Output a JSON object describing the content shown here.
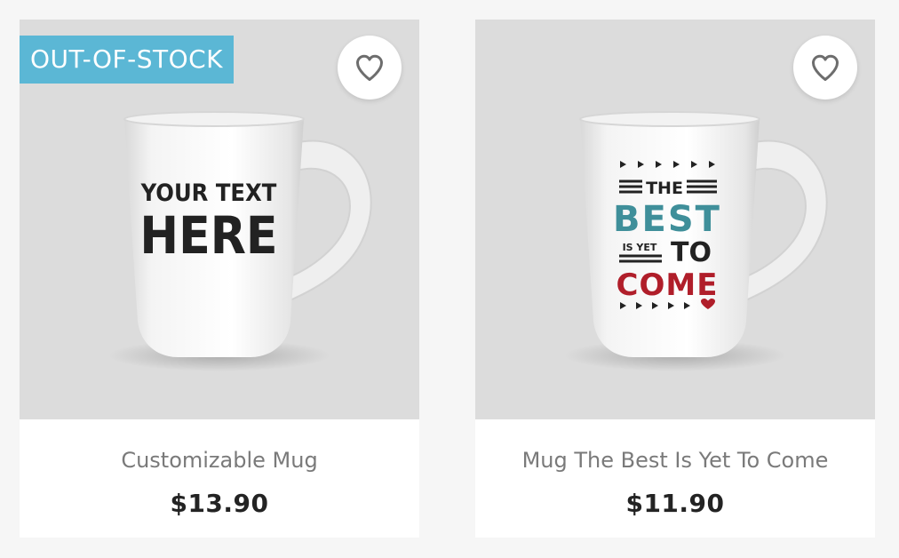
{
  "products": [
    {
      "badge": "OUT-OF-STOCK",
      "name": "Customizable Mug",
      "price": "$13.90",
      "mug_print": {
        "line1": "YOUR TEXT",
        "line2": "HERE"
      },
      "wishlist_icon": "heart-outline-icon"
    },
    {
      "name": "Mug The Best Is Yet To Come",
      "price": "$11.90",
      "mug_print": {
        "w1": "THE",
        "w2": "BEST",
        "w3": "IS YET",
        "w4": "TO",
        "w5": "COME"
      },
      "wishlist_icon": "heart-outline-icon"
    }
  ],
  "colors": {
    "badge_bg": "#5bb7d5",
    "best_teal": "#3f8f9a",
    "come_red": "#b01e2a"
  }
}
